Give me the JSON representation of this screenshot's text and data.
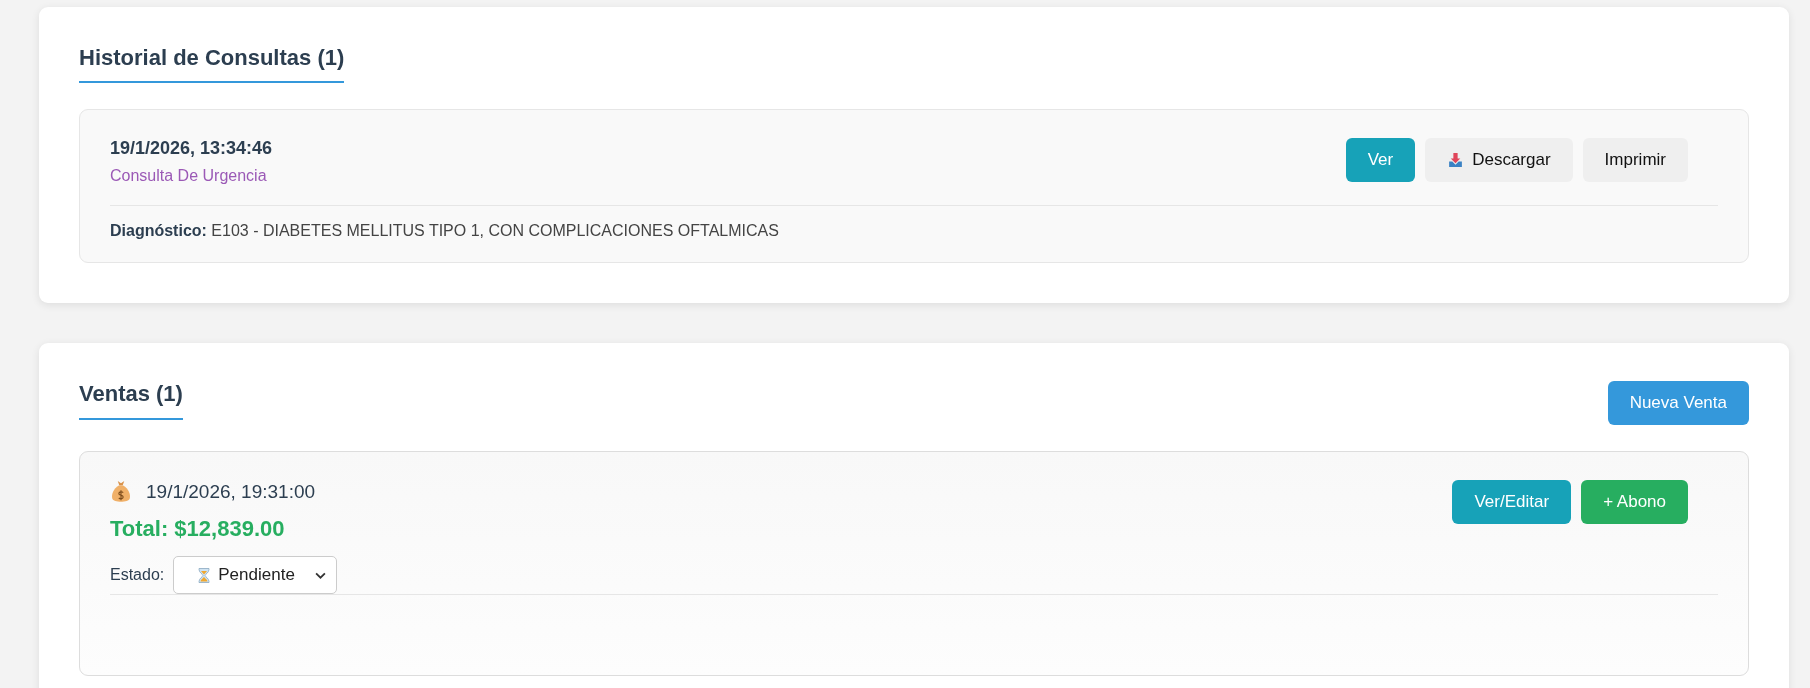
{
  "consultas": {
    "title": "Historial de Consultas (1)",
    "items": [
      {
        "datetime": "19/1/2026, 13:34:46",
        "type": "Consulta De Urgencia",
        "diagnosis_label": "Diagnóstico:",
        "diagnosis": "E103 - DIABETES MELLITUS TIPO 1, CON COMPLICACIONES OFTALMICAS",
        "buttons": [
          {
            "kind": "primary",
            "label": "Ver"
          },
          {
            "kind": "download",
            "label": "Descargar"
          },
          {
            "kind": "secondary",
            "label": "Imprimir"
          }
        ]
      }
    ]
  },
  "ventas": {
    "title": "Ventas (1)",
    "new_button": "Nueva Venta",
    "items": [
      {
        "datetime": "19/1/2026, 19:31:00",
        "total": "Total: $12,839.00",
        "status_label": "Estado:",
        "status": "Pendiente",
        "buttons": [
          {
            "kind": "primary",
            "label": "Ver/Editar"
          },
          {
            "kind": "success",
            "label": "+ Abono"
          }
        ]
      }
    ]
  }
}
